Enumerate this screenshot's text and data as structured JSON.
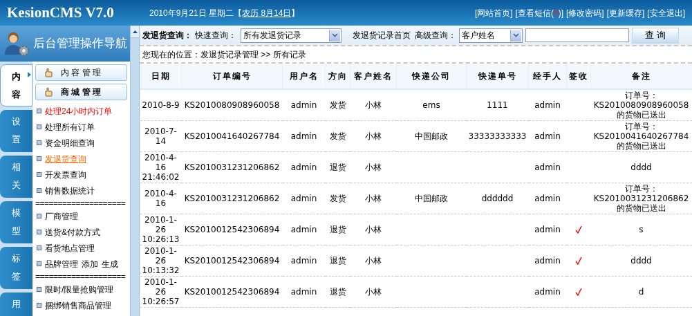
{
  "header": {
    "logo": "KesionCMS V7.0",
    "date": {
      "text": "2010年9月21日 星期二【",
      "lunar": "农历 8月14日",
      "close": "】"
    },
    "links": [
      {
        "label": "[网站首页]"
      },
      {
        "label": "[查看短信(",
        "count": "0",
        "tail": ")]"
      },
      {
        "label": "[修改密码]"
      },
      {
        "label": "[更新缓存]"
      },
      {
        "label": "[安全退出]"
      }
    ]
  },
  "sidebar": {
    "title": "后台管理操作导航",
    "tabs": [
      {
        "label": "内容",
        "selected": true
      },
      {
        "label": "设置",
        "selected": false
      },
      {
        "label": "相关",
        "selected": false
      },
      {
        "label": "模型",
        "selected": false
      },
      {
        "label": "标签",
        "selected": false
      },
      {
        "label": "用",
        "selected": false
      }
    ],
    "menu": [
      {
        "kind": "section",
        "label": "内 容 管 理",
        "expanded": false
      },
      {
        "kind": "section",
        "label": "商 城 管 理",
        "expanded": true
      },
      {
        "kind": "link",
        "label": "处理24小时内订单",
        "highlight": true,
        "selected": false
      },
      {
        "kind": "link",
        "label": "处理所有订单",
        "highlight": false,
        "selected": false
      },
      {
        "kind": "link",
        "label": "资金明细查询",
        "highlight": false,
        "selected": false
      },
      {
        "kind": "link",
        "label": "发退货查询",
        "highlight": false,
        "selected": true
      },
      {
        "kind": "link",
        "label": "开发票查询",
        "highlight": false,
        "selected": false
      },
      {
        "kind": "link",
        "label": "销售数据统计",
        "highlight": false,
        "selected": false
      },
      {
        "kind": "divider",
        "text": "===================="
      },
      {
        "kind": "link",
        "label": "厂商管理",
        "highlight": false,
        "selected": false
      },
      {
        "kind": "link",
        "label": "送货&付款方式",
        "highlight": false,
        "selected": false
      },
      {
        "kind": "link",
        "label": "看货地点管理",
        "highlight": false,
        "selected": false
      },
      {
        "kind": "link",
        "label": "品牌管理",
        "extras": [
          "添加",
          "生成"
        ],
        "highlight": false,
        "selected": false
      },
      {
        "kind": "divider",
        "text": "===================="
      },
      {
        "kind": "link",
        "label": "限时/限量抢购管理",
        "highlight": false,
        "selected": false
      },
      {
        "kind": "link",
        "label": "捆绑销售商品管理",
        "highlight": false,
        "selected": false
      }
    ]
  },
  "toolbar": {
    "title": "发退货查询：",
    "quick_label": "快速查询：",
    "quick_select": "所有发退货记录",
    "home_link": "发退货记录首页",
    "advanced_label": "高级查询：",
    "advanced_select": "客户姓名",
    "button": "查 询"
  },
  "breadcrumb": "您现在的位置：发退货记录管理 >> 所有记录",
  "table": {
    "columns": [
      "日期",
      "订单编号",
      "用户名",
      "方向",
      "客户姓名",
      "快递公司",
      "快递单号",
      "经手人",
      "签收",
      "备注"
    ],
    "rows": [
      {
        "date": "2010-8-9",
        "order_no": "KS2010080908960058",
        "user": "admin",
        "direction": "发货",
        "customer": "小林",
        "courier": "ems",
        "tracking": "1111",
        "handler": "admin",
        "signed": false,
        "note": "订单号：\nKS2010080908960058\n的货物已送出"
      },
      {
        "date": "2010-7-14",
        "order_no": "KS2010041640267784",
        "user": "admin",
        "direction": "发货",
        "customer": "小林",
        "courier": "中国邮政",
        "tracking": "33333333333",
        "handler": "admin",
        "signed": false,
        "note": "订单号：\nKS2010041640267784\n的货物已送出"
      },
      {
        "date": "2010-4-16 21:46:02",
        "order_no": "KS2010031231206862",
        "user": "admin",
        "direction": "退货",
        "customer": "小林",
        "handler": "admin",
        "signed": false,
        "note": "dddd"
      },
      {
        "date": "2010-4-16",
        "order_no": "KS2010031231206862",
        "user": "admin",
        "direction": "发货",
        "customer": "小林",
        "courier": "中国邮政",
        "tracking": "dddddd",
        "handler": "admin",
        "signed": false,
        "note": "订单号：\nKS2010031231206862\n的货物已送出"
      },
      {
        "date": "2010-1-26 10:26:13",
        "order_no": "KS2010012542306894",
        "user": "admin",
        "direction": "退货",
        "customer": "小林",
        "handler": "admin",
        "signed": true,
        "note": "s"
      },
      {
        "date": "2010-1-26 10:13:32",
        "order_no": "KS2010012542306894",
        "user": "admin",
        "direction": "退货",
        "customer": "小林",
        "handler": "admin",
        "signed": true,
        "note": "dddd"
      },
      {
        "date": "2010-1-26 10:26:57",
        "order_no": "KS2010012542306894",
        "user": "admin",
        "direction": "退货",
        "customer": "小林",
        "handler": "admin",
        "signed": true,
        "note": "d"
      }
    ]
  }
}
